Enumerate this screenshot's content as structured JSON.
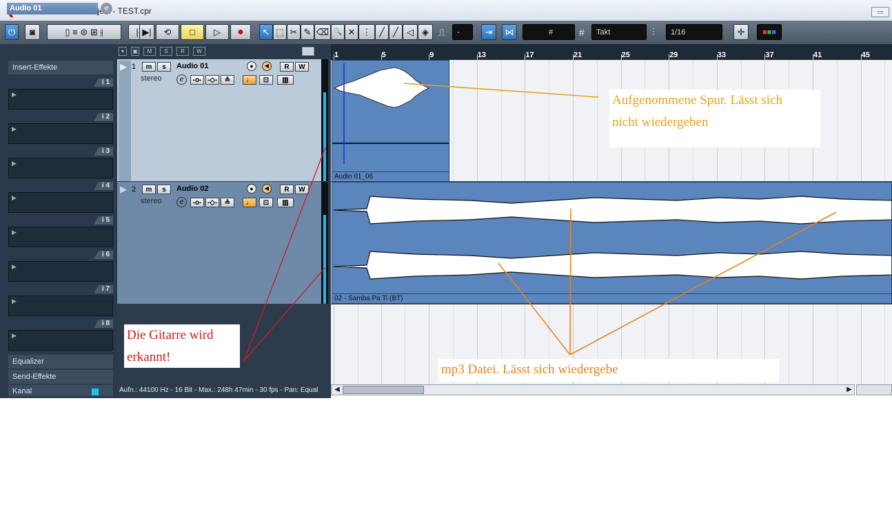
{
  "window": {
    "title": "Cubase Studio 4-Projekt - TEST.cpr",
    "logo_icon": "cubase-logo-icon",
    "restore_glyph": "▭"
  },
  "toolbar": {
    "transport_glyphs": [
      "|◀",
      "▶|",
      "⟲",
      "□",
      "▷",
      "●"
    ],
    "tool_glyphs": [
      "↖",
      "⬚",
      "✂",
      "✎",
      "⌫",
      "🔍",
      "✕",
      "⋮",
      "╱",
      "◁",
      "◈"
    ],
    "quantize_mode": "-",
    "grid_type": "Takt",
    "quantize_value": "1/16",
    "snap_glyph": "#"
  },
  "inspector": {
    "track_name": "Audio 01",
    "edit_glyph": "e",
    "inserts_label": "Insert-Effekte",
    "insert_slots": [
      "i 1",
      "i 2",
      "i 3",
      "i 4",
      "i 5",
      "i 6",
      "i 7",
      "i 8"
    ],
    "equalizer_label": "Equalizer",
    "sends_label": "Send-Effekte",
    "channel_label": "Kanal"
  },
  "tracks": [
    {
      "number": "1",
      "name": "Audio 01",
      "type": "stereo",
      "mute": "m",
      "solo": "s",
      "read": "R",
      "write": "W",
      "edit": "e"
    },
    {
      "number": "2",
      "name": "Audio 02",
      "type": "stereo",
      "mute": "m",
      "solo": "s",
      "read": "R",
      "write": "W",
      "edit": "e"
    }
  ],
  "ruler": {
    "bars": [
      "1",
      "5",
      "9",
      "13",
      "17",
      "21",
      "25",
      "29",
      "33",
      "37",
      "41",
      "45"
    ]
  },
  "events": [
    {
      "name": "Audio 01_06"
    },
    {
      "name": "02 - Samba Pa Ti (BT)"
    }
  ],
  "status_bar": {
    "text": "Aufn.: 44100 Hz - 16 Bit - Max.: 248h 47min - 30 fps - Pan: Equal"
  },
  "annotations": {
    "recorded_line1": "Aufgenommene Spur. Lässt sich",
    "recorded_line2": "nicht wiedergeben",
    "guitar_line1": "Die Gitarre wird",
    "guitar_line2": "erkannt!",
    "mp3": "mp3 Datei. Lässt sich wiedergebe"
  },
  "colors": {
    "event_blue": "#5a85bd",
    "annotation_orange": "#e8a21a",
    "annotation_red": "#d11a1a",
    "meter_cyan": "#26b7e8"
  }
}
